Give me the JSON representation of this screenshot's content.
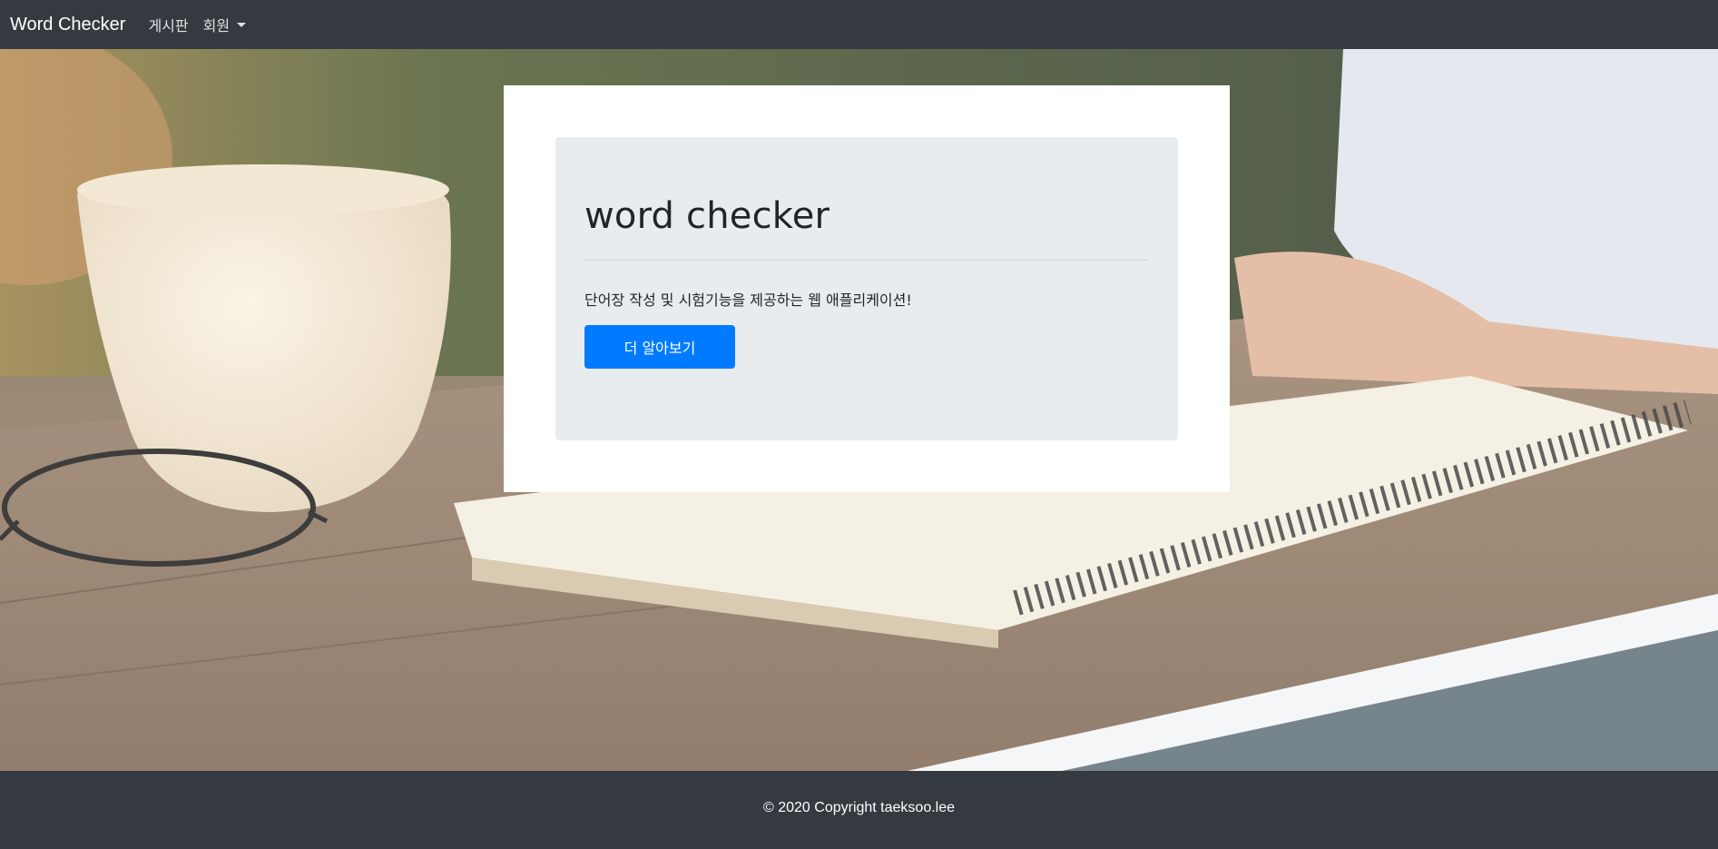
{
  "navbar": {
    "brand": "Word Checker",
    "links": [
      {
        "label": "게시판"
      },
      {
        "label": "회원"
      }
    ]
  },
  "hero": {
    "title": "word checker",
    "description": "단어장 작성 및 시험기능을 제공하는 웹 애플리케이션!",
    "button_label": "더 알아보기"
  },
  "footer": {
    "text": "© 2020 Copyright  taeksoo.lee"
  },
  "colors": {
    "navbar_bg": "#343a40",
    "jumbotron_bg": "#e9ecef",
    "primary": "#007bff"
  }
}
